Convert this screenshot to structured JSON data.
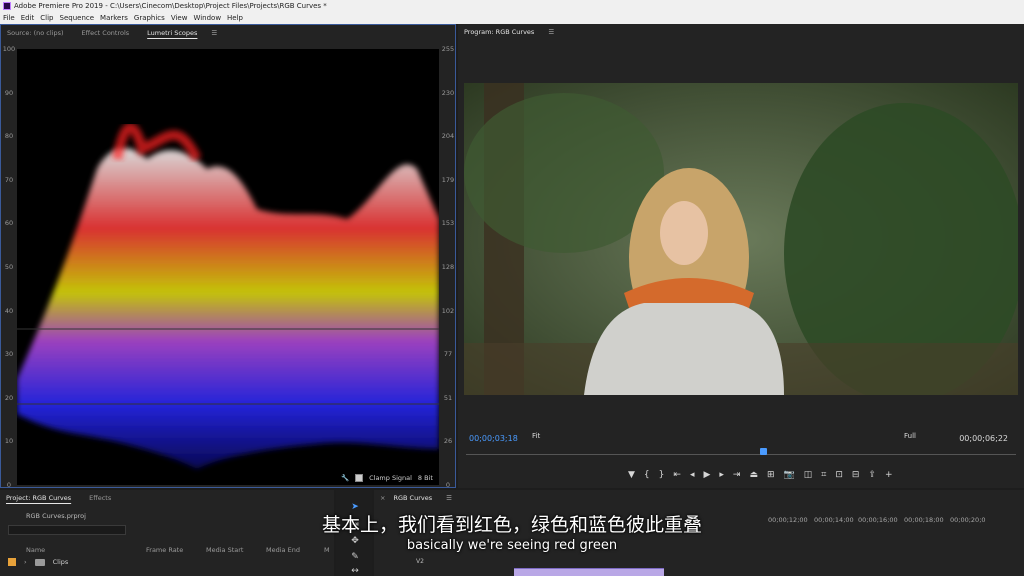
{
  "window": {
    "title": "Adobe Premiere Pro 2019 - C:\\Users\\Cinecom\\Desktop\\Project Files\\Projects\\RGB Curves *"
  },
  "menu": [
    "File",
    "Edit",
    "Clip",
    "Sequence",
    "Markers",
    "Graphics",
    "View",
    "Window",
    "Help"
  ],
  "source_panel": {
    "tabs": [
      "Source: (no clips)",
      "Effect Controls",
      "Lumetri Scopes"
    ],
    "active_tab": "Lumetri Scopes",
    "y_left": [
      "100",
      "90",
      "80",
      "70",
      "60",
      "50",
      "40",
      "30",
      "20",
      "10",
      "0"
    ],
    "y_right": [
      "255",
      "230",
      "204",
      "179",
      "153",
      "128",
      "102",
      "77",
      "51",
      "26",
      "0"
    ],
    "clamp_signal": "Clamp Signal",
    "bit_depth": "8 Bit"
  },
  "program_panel": {
    "title": "Program: RGB Curves",
    "timecode_current": "00;00;03;18",
    "fit": "Fit",
    "quality": "Full",
    "timecode_duration": "00;00;06;22",
    "progress": 0.54
  },
  "project_panel": {
    "tabs": [
      "Project: RGB Curves",
      "Effects"
    ],
    "file": "RGB Curves.prproj",
    "columns": [
      "Name",
      "Frame Rate",
      "Media Start",
      "Media End",
      "M"
    ],
    "items": [
      {
        "name": "Clips"
      }
    ]
  },
  "timeline_panel": {
    "title": "RGB Curves",
    "ticks": [
      "00;00;12;00",
      "00;00;14;00",
      "00;00;16;00",
      "00;00;18;00",
      "00;00;20;0"
    ],
    "track": "V2"
  },
  "subtitles": {
    "cn": "基本上，我们看到红色，绿色和蓝色彼此重叠",
    "en": "basically we're seeing red green"
  },
  "colors": {
    "accent": "#4a9bff",
    "panel_bg": "#232323",
    "clip": "#b9a7e6"
  }
}
